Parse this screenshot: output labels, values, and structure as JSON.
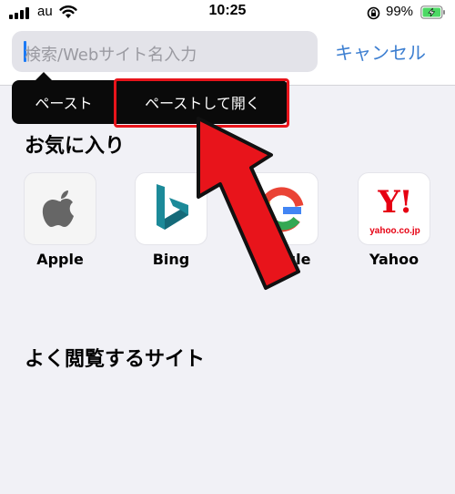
{
  "status_bar": {
    "carrier": "au",
    "time": "10:25",
    "battery_percent": "99%",
    "icons": [
      "signal-icon",
      "wifi-icon",
      "rotation-lock-icon",
      "battery-charging-icon"
    ]
  },
  "search": {
    "placeholder": "検索/Webサイト名入力",
    "cancel_label": "キャンセル"
  },
  "edit_menu": {
    "items": [
      {
        "label": "ペースト"
      },
      {
        "label": "ペーストして開く"
      }
    ],
    "highlighted_item": "ペーストして開く",
    "highlight_color": "#e8141b"
  },
  "favorites": {
    "title": "お気に入り",
    "items": [
      {
        "label": "Apple",
        "icon": "apple-logo-icon"
      },
      {
        "label": "Bing",
        "icon": "bing-logo-icon"
      },
      {
        "label": "Google",
        "icon": "google-logo-icon"
      },
      {
        "label": "Yahoo",
        "icon": "yahoo-logo-icon",
        "logo_text": "Y!",
        "logo_subtext": "yahoo.co.jp"
      }
    ]
  },
  "frequently_visited": {
    "title": "よく閲覧するサイト"
  },
  "colors": {
    "accent": "#3d7fd1",
    "caret": "#1c7af5",
    "annotation_red": "#e8141b"
  }
}
